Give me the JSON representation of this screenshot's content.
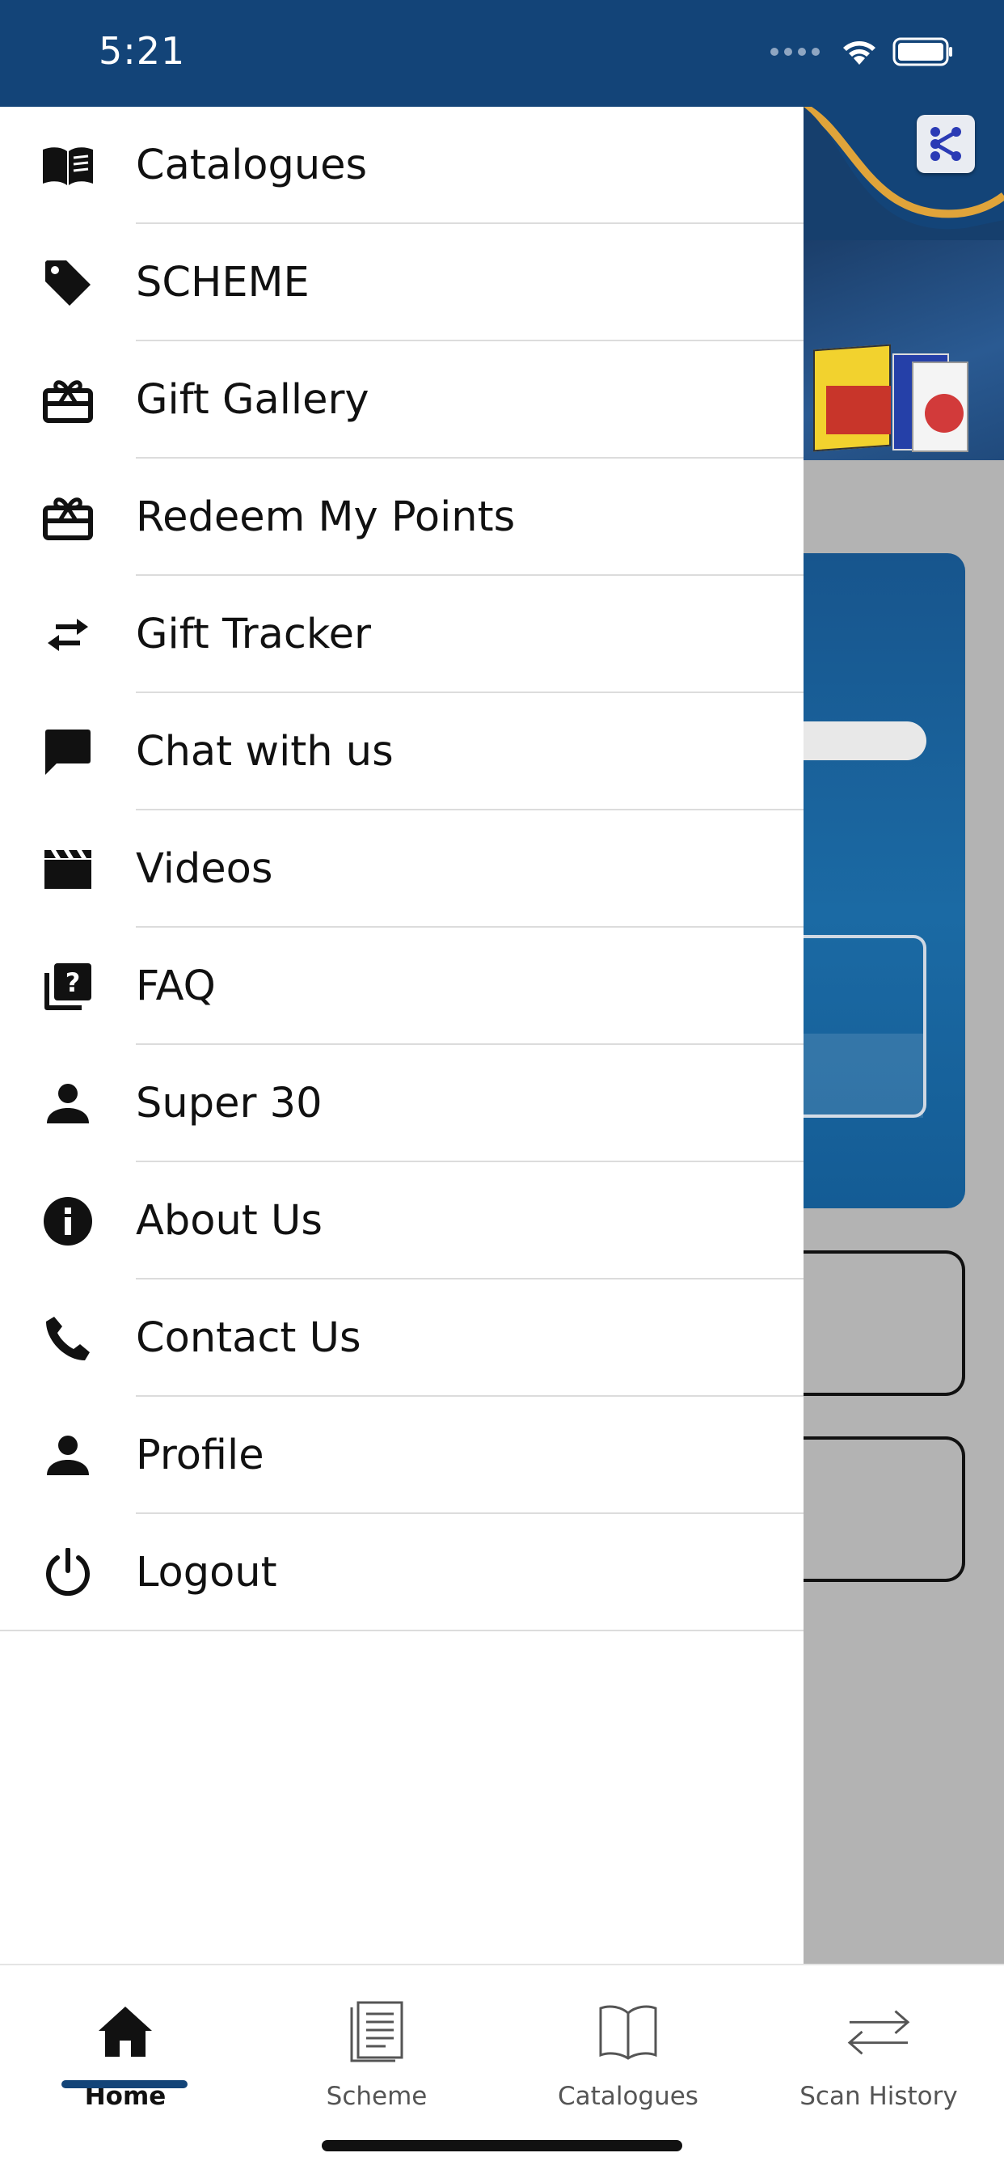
{
  "status_bar": {
    "time": "5:21",
    "icons": [
      "signal-dots-icon",
      "wifi-icon",
      "battery-icon"
    ]
  },
  "drawer": {
    "items": [
      {
        "label": "Catalogues",
        "icon": "book-open-icon"
      },
      {
        "label": "SCHEME",
        "icon": "tag-icon"
      },
      {
        "label": "Gift Gallery",
        "icon": "gift-card-icon"
      },
      {
        "label": "Redeem My Points",
        "icon": "gift-card-icon"
      },
      {
        "label": "Gift Tracker",
        "icon": "swap-arrows-icon"
      },
      {
        "label": "Chat with us",
        "icon": "chat-icon"
      },
      {
        "label": "Videos",
        "icon": "clapperboard-icon"
      },
      {
        "label": "FAQ",
        "icon": "question-library-icon"
      },
      {
        "label": "Super 30",
        "icon": "person-icon"
      },
      {
        "label": "About Us",
        "icon": "info-icon"
      },
      {
        "label": "Contact Us",
        "icon": "phone-icon"
      },
      {
        "label": "Profile",
        "icon": "person-icon"
      },
      {
        "label": "Logout",
        "icon": "power-icon"
      }
    ]
  },
  "bottom_nav": {
    "active": "Home",
    "accent_color": "#134478",
    "items": [
      {
        "label": "Home",
        "icon": "home-icon"
      },
      {
        "label": "Scheme",
        "icon": "document-icon"
      },
      {
        "label": "Catalogues",
        "icon": "book-outline-icon"
      },
      {
        "label": "Scan History",
        "icon": "swap-arrows-icon"
      }
    ]
  },
  "colors": {
    "brand_blue": "#134478",
    "overlay_gray": "#b3b3b3",
    "accent_gold": "#e0a43a"
  }
}
